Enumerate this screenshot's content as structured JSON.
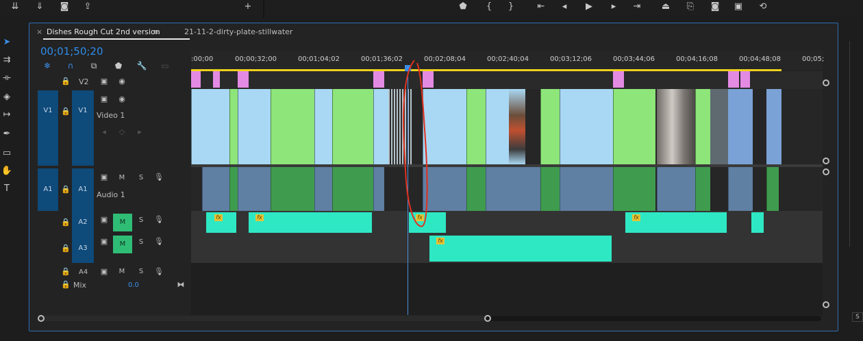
{
  "top_bar": {
    "left_icons": [
      "insert-icon",
      "overwrite-icon",
      "camera-icon",
      "export-icon",
      "plus-icon"
    ],
    "transport_icons": [
      "marker-icon",
      "mark-in-icon",
      "mark-out-icon",
      "go-to-in-icon",
      "step-back-icon",
      "play-icon",
      "step-forward-icon",
      "go-to-out-icon",
      "lift-icon",
      "extract-icon",
      "export-frame-icon",
      "comparison-icon",
      "settings-icon"
    ]
  },
  "tools": [
    "selection-tool-icon",
    "track-select-icon",
    "ripple-edit-icon",
    "razor-tool-icon",
    "slip-tool-icon",
    "pen-tool-icon",
    "rectangle-tool-icon",
    "hand-tool-icon",
    "type-tool-icon"
  ],
  "timeline": {
    "tab_active": "Dishes Rough Cut 2nd version",
    "tab_other": "21-11-2-dirty-plate-stillwater",
    "close_glyph": "×",
    "menu_glyph": "≡",
    "timecode": "00;01;50;20",
    "ruler_labels": [
      ":00;00",
      "00;00;32;00",
      "00;01;04;02",
      "00;01;36;02",
      "00;02;08;04",
      "00;02;40;04",
      "00;03;12;06",
      "00;03;44;06",
      "00;04;16;08",
      "00;04;48;08",
      "00;05;"
    ]
  },
  "tracks": {
    "v2": {
      "target": "V2"
    },
    "v1": {
      "source": "V1",
      "target": "V1",
      "name": "Video 1"
    },
    "a1": {
      "source": "A1",
      "target": "A1",
      "name": "Audio 1",
      "m": "M",
      "s": "S"
    },
    "a2": {
      "target": "A2",
      "m": "M",
      "s": "S"
    },
    "a3": {
      "target": "A3",
      "m": "M",
      "s": "S"
    },
    "a4": {
      "target": "A4",
      "m": "M",
      "s": "S"
    },
    "mix": {
      "label": "Mix",
      "value": "0.0"
    }
  },
  "fx_label": "fx",
  "corner_label": "S",
  "colors": {
    "accent_blue": "#2d8ceb",
    "video_clip": "#a9d8f4",
    "video_clip_green": "#8ee57a",
    "pink_clip": "#e38ae3",
    "audio_clip": "#5f7fa3",
    "audio_teal": "#2ee8c4",
    "work_area": "#efd21c",
    "annotation": "#e0301e"
  }
}
